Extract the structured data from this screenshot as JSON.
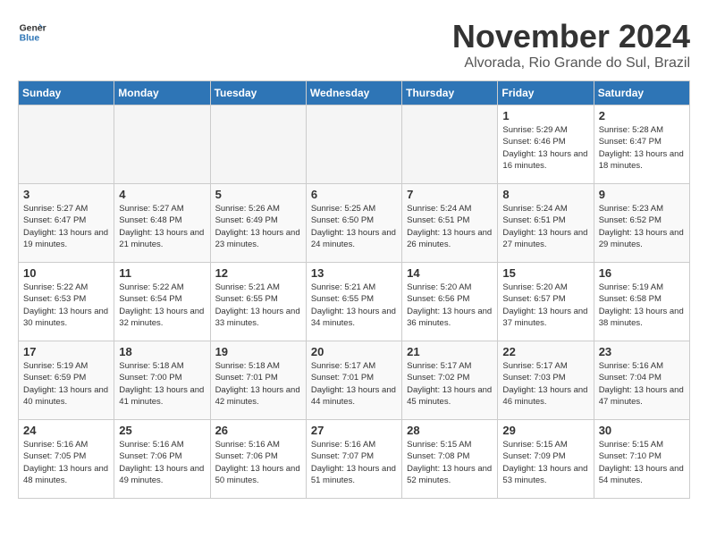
{
  "header": {
    "logo_line1": "General",
    "logo_line2": "Blue",
    "month_year": "November 2024",
    "location": "Alvorada, Rio Grande do Sul, Brazil"
  },
  "weekdays": [
    "Sunday",
    "Monday",
    "Tuesday",
    "Wednesday",
    "Thursday",
    "Friday",
    "Saturday"
  ],
  "weeks": [
    [
      {
        "day": "",
        "info": ""
      },
      {
        "day": "",
        "info": ""
      },
      {
        "day": "",
        "info": ""
      },
      {
        "day": "",
        "info": ""
      },
      {
        "day": "",
        "info": ""
      },
      {
        "day": "1",
        "info": "Sunrise: 5:29 AM\nSunset: 6:46 PM\nDaylight: 13 hours and 16 minutes."
      },
      {
        "day": "2",
        "info": "Sunrise: 5:28 AM\nSunset: 6:47 PM\nDaylight: 13 hours and 18 minutes."
      }
    ],
    [
      {
        "day": "3",
        "info": "Sunrise: 5:27 AM\nSunset: 6:47 PM\nDaylight: 13 hours and 19 minutes."
      },
      {
        "day": "4",
        "info": "Sunrise: 5:27 AM\nSunset: 6:48 PM\nDaylight: 13 hours and 21 minutes."
      },
      {
        "day": "5",
        "info": "Sunrise: 5:26 AM\nSunset: 6:49 PM\nDaylight: 13 hours and 23 minutes."
      },
      {
        "day": "6",
        "info": "Sunrise: 5:25 AM\nSunset: 6:50 PM\nDaylight: 13 hours and 24 minutes."
      },
      {
        "day": "7",
        "info": "Sunrise: 5:24 AM\nSunset: 6:51 PM\nDaylight: 13 hours and 26 minutes."
      },
      {
        "day": "8",
        "info": "Sunrise: 5:24 AM\nSunset: 6:51 PM\nDaylight: 13 hours and 27 minutes."
      },
      {
        "day": "9",
        "info": "Sunrise: 5:23 AM\nSunset: 6:52 PM\nDaylight: 13 hours and 29 minutes."
      }
    ],
    [
      {
        "day": "10",
        "info": "Sunrise: 5:22 AM\nSunset: 6:53 PM\nDaylight: 13 hours and 30 minutes."
      },
      {
        "day": "11",
        "info": "Sunrise: 5:22 AM\nSunset: 6:54 PM\nDaylight: 13 hours and 32 minutes."
      },
      {
        "day": "12",
        "info": "Sunrise: 5:21 AM\nSunset: 6:55 PM\nDaylight: 13 hours and 33 minutes."
      },
      {
        "day": "13",
        "info": "Sunrise: 5:21 AM\nSunset: 6:55 PM\nDaylight: 13 hours and 34 minutes."
      },
      {
        "day": "14",
        "info": "Sunrise: 5:20 AM\nSunset: 6:56 PM\nDaylight: 13 hours and 36 minutes."
      },
      {
        "day": "15",
        "info": "Sunrise: 5:20 AM\nSunset: 6:57 PM\nDaylight: 13 hours and 37 minutes."
      },
      {
        "day": "16",
        "info": "Sunrise: 5:19 AM\nSunset: 6:58 PM\nDaylight: 13 hours and 38 minutes."
      }
    ],
    [
      {
        "day": "17",
        "info": "Sunrise: 5:19 AM\nSunset: 6:59 PM\nDaylight: 13 hours and 40 minutes."
      },
      {
        "day": "18",
        "info": "Sunrise: 5:18 AM\nSunset: 7:00 PM\nDaylight: 13 hours and 41 minutes."
      },
      {
        "day": "19",
        "info": "Sunrise: 5:18 AM\nSunset: 7:01 PM\nDaylight: 13 hours and 42 minutes."
      },
      {
        "day": "20",
        "info": "Sunrise: 5:17 AM\nSunset: 7:01 PM\nDaylight: 13 hours and 44 minutes."
      },
      {
        "day": "21",
        "info": "Sunrise: 5:17 AM\nSunset: 7:02 PM\nDaylight: 13 hours and 45 minutes."
      },
      {
        "day": "22",
        "info": "Sunrise: 5:17 AM\nSunset: 7:03 PM\nDaylight: 13 hours and 46 minutes."
      },
      {
        "day": "23",
        "info": "Sunrise: 5:16 AM\nSunset: 7:04 PM\nDaylight: 13 hours and 47 minutes."
      }
    ],
    [
      {
        "day": "24",
        "info": "Sunrise: 5:16 AM\nSunset: 7:05 PM\nDaylight: 13 hours and 48 minutes."
      },
      {
        "day": "25",
        "info": "Sunrise: 5:16 AM\nSunset: 7:06 PM\nDaylight: 13 hours and 49 minutes."
      },
      {
        "day": "26",
        "info": "Sunrise: 5:16 AM\nSunset: 7:06 PM\nDaylight: 13 hours and 50 minutes."
      },
      {
        "day": "27",
        "info": "Sunrise: 5:16 AM\nSunset: 7:07 PM\nDaylight: 13 hours and 51 minutes."
      },
      {
        "day": "28",
        "info": "Sunrise: 5:15 AM\nSunset: 7:08 PM\nDaylight: 13 hours and 52 minutes."
      },
      {
        "day": "29",
        "info": "Sunrise: 5:15 AM\nSunset: 7:09 PM\nDaylight: 13 hours and 53 minutes."
      },
      {
        "day": "30",
        "info": "Sunrise: 5:15 AM\nSunset: 7:10 PM\nDaylight: 13 hours and 54 minutes."
      }
    ]
  ]
}
